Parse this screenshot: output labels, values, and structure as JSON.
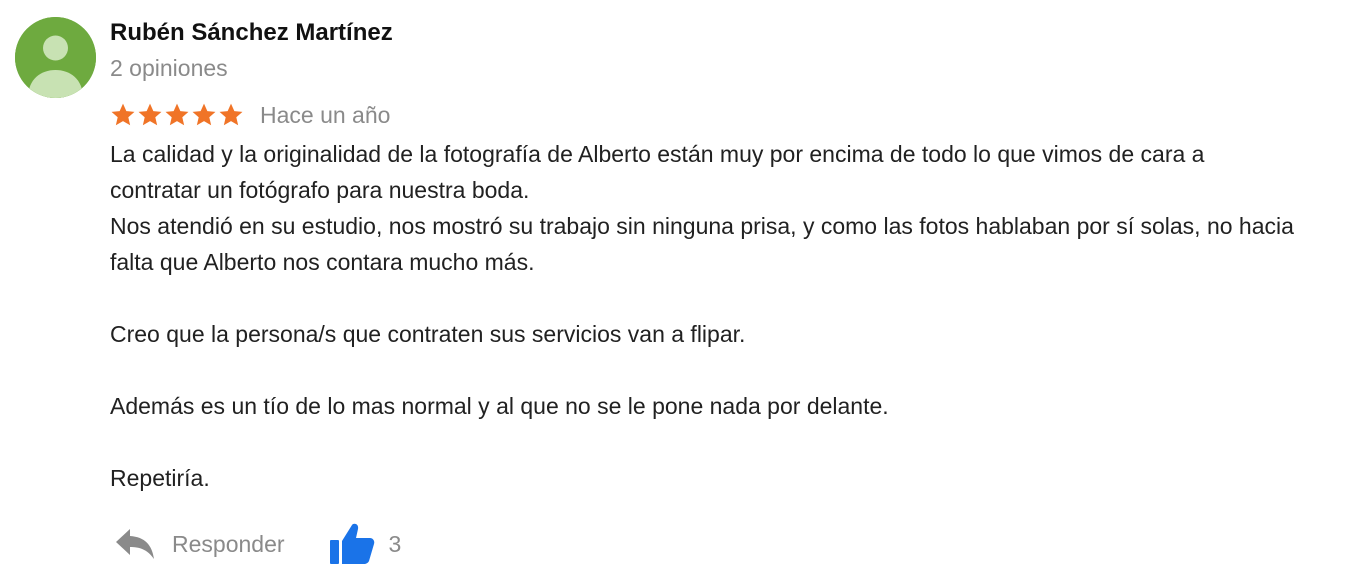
{
  "review": {
    "author": {
      "name": "Rubén Sánchez Martínez",
      "meta": "2 opiniones",
      "avatar_icon": "user-silhouette-icon",
      "avatar_color": "#6eaa3f"
    },
    "rating": {
      "value": 5,
      "max": 5,
      "star_color": "#f07427",
      "date": "Hace un año"
    },
    "paragraphs": [
      {
        "lines": [
          "La calidad y la originalidad de la fotografía de Alberto están muy por encima de todo lo que vimos de cara a contratar un fotógrafo para nuestra boda.",
          "Nos atendió en su estudio, nos mostró su trabajo sin ninguna prisa, y como las fotos hablaban por sí solas, no hacia falta que Alberto nos contara mucho más."
        ]
      },
      {
        "lines": [
          "Creo que la persona/s que contraten sus servicios van a flipar."
        ]
      },
      {
        "lines": [
          "Además es un tío de lo mas normal y al que no se le pone nada por delante."
        ]
      },
      {
        "lines": [
          "Repetiría."
        ]
      }
    ],
    "actions": {
      "reply_label": "Responder",
      "reply_icon": "reply-arrow-icon",
      "like_count": "3",
      "like_icon": "thumbs-up-icon",
      "like_color": "#1a73e8",
      "muted_color": "#8a8a8a"
    }
  }
}
